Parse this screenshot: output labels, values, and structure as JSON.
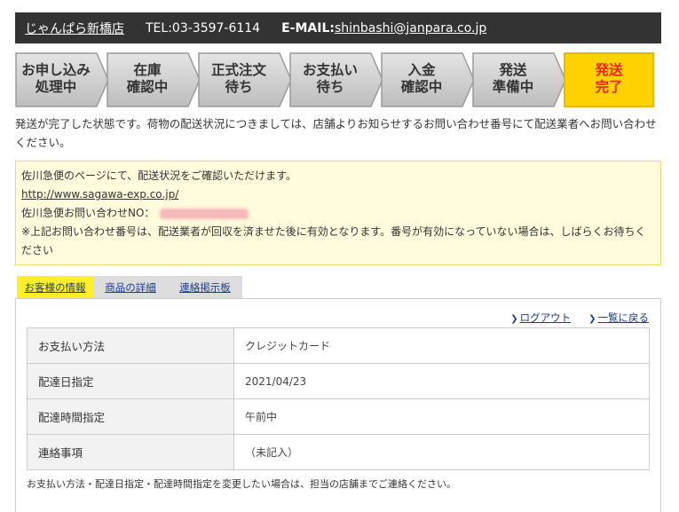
{
  "header": {
    "shop_name": "じゃんぱら新橋店",
    "tel": "TEL:03-3597-6114",
    "email_label": "E-MAIL:",
    "email": "shinbashi@janpara.co.jp"
  },
  "steps": [
    {
      "label": "お申し込み\n処理中",
      "state": "done"
    },
    {
      "label": "在庫\n確認中",
      "state": "done"
    },
    {
      "label": "正式注文\n待ち",
      "state": "done"
    },
    {
      "label": "お支払い\n待ち",
      "state": "done"
    },
    {
      "label": "入金\n確認中",
      "state": "done"
    },
    {
      "label": "発送\n準備中",
      "state": "done"
    },
    {
      "label": "発送\n完了",
      "state": "current"
    }
  ],
  "intro_text": "発送が完了した状態です。荷物の配送状況につきましては、店舗よりお知らせするお問い合わせ番号にて配送業者へお問い合わせください。",
  "notice": {
    "line1": "佐川急便のページにて、配送状況をご確認いただけます。",
    "link": "http://www.sagawa-exp.co.jp/",
    "tracking_label": "佐川急便お問い合わせNO：",
    "note": "※上記お問い合わせ番号は、配送業者が回収を済ませた後に有効となります。番号が有効になっていない場合は、しばらくお待ちください"
  },
  "tabs": [
    {
      "label": "お客様の情報",
      "active": true
    },
    {
      "label": "商品の詳細",
      "active": false
    },
    {
      "label": "連絡掲示板",
      "active": false
    }
  ],
  "panel_links": {
    "logout": "ログアウト",
    "back_to_list": "一覧に戻る"
  },
  "info_rows": [
    {
      "key": "お支払い方法",
      "value": "クレジットカード"
    },
    {
      "key": "配達日指定",
      "value": "2021/04/23"
    },
    {
      "key": "配達時間指定",
      "value": "午前中"
    },
    {
      "key": "連絡事項",
      "value": "（未記入）"
    }
  ],
  "footnote": "お支払い方法・配達日指定・配達時間指定を変更したい場合は、担当の店舗までご連絡ください。",
  "colors": {
    "header_bg": "#333333",
    "step_bg": "#cccccc",
    "step_current_bg": "#ffd200",
    "step_current_text": "#e8281e",
    "notice_bg": "#fffbdc",
    "tab_active_bg": "#ffef2b"
  }
}
